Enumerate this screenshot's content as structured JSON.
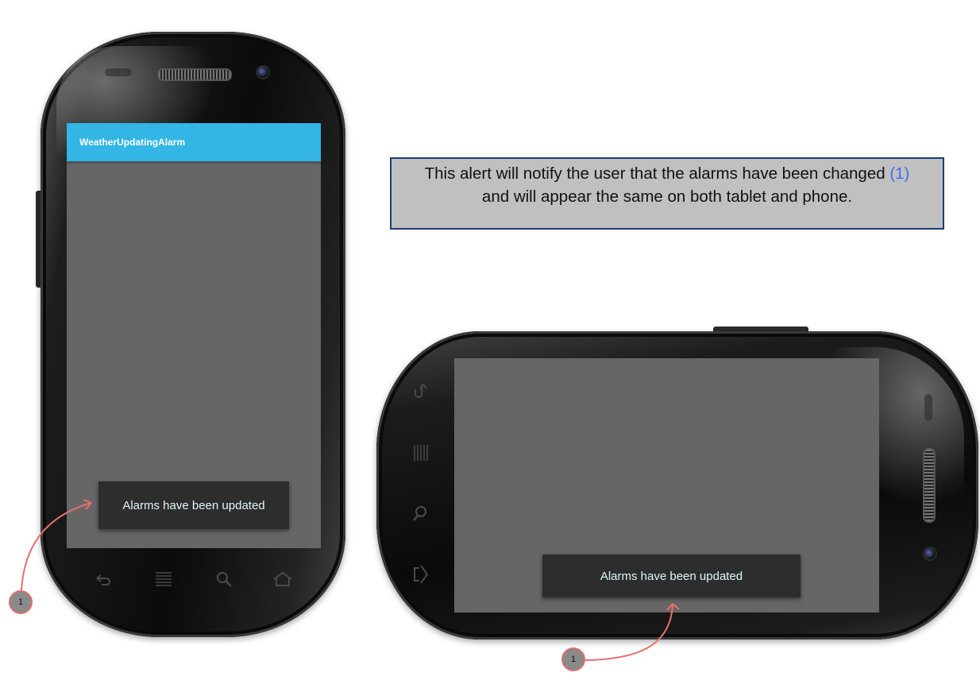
{
  "portrait_phone": {
    "app_title": "WeatherUpdatingAlarm",
    "toast_text": "Alarms have been updated",
    "softkeys": [
      "back-icon",
      "menu-icon",
      "search-icon",
      "home-icon"
    ]
  },
  "landscape_phone": {
    "toast_text": "Alarms have been updated",
    "softkeys": [
      "back-icon",
      "menu-icon",
      "search-icon",
      "home-icon"
    ]
  },
  "annotation": {
    "text_before": "This alert will notify the user that the alarms have been changed ",
    "ref": "(1)",
    "text_after": " and will appear the same on both tablet and phone."
  },
  "markers": [
    "1",
    "1"
  ],
  "colors": {
    "action_bar": "#33b5e5",
    "screen_bg": "#666666",
    "toast_bg": "#2d2d2d",
    "callout_bg": "#c0c0c0",
    "callout_border": "#1f3a7a",
    "arrow": "#e87070",
    "ref_link": "#3b6cf5"
  }
}
